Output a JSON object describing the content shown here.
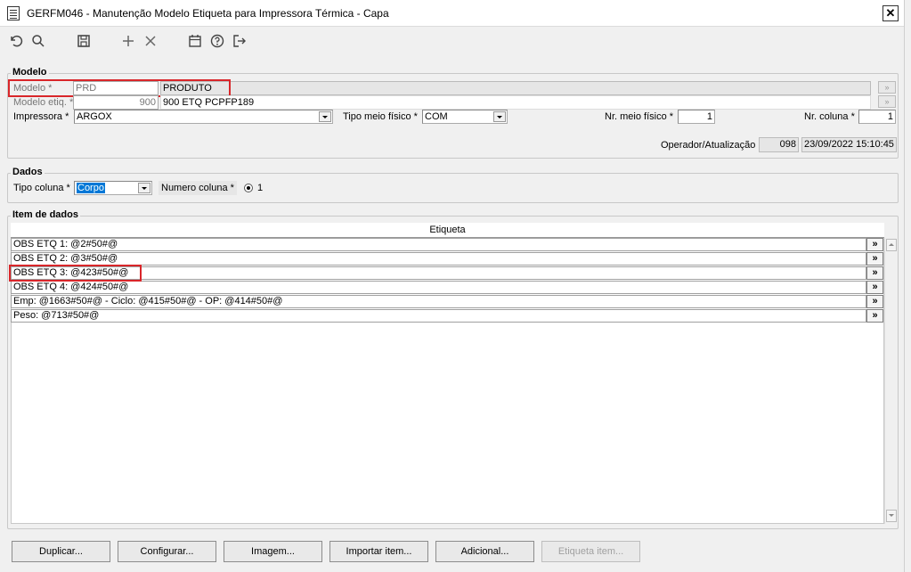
{
  "window": {
    "title": "GERFM046 - Manutenção Modelo Etiqueta para Impressora Térmica - Capa",
    "close_label": "✕"
  },
  "toolbar": {
    "icons": [
      "undo-icon",
      "search-icon",
      "save-icon",
      "add-icon",
      "delete-icon",
      "calendar-icon",
      "help-icon",
      "exit-icon"
    ]
  },
  "modelo": {
    "group_label": "Modelo",
    "modelo_label": "Modelo *",
    "modelo_value": "PRD",
    "modelo_desc": "PRODUTO",
    "modelo_etiq_label": "Modelo etiq. *",
    "modelo_etiq_value": "900",
    "modelo_etiq_desc": "900 ETQ PCPFP189",
    "impressora_label": "Impressora *",
    "impressora_value": "ARGOX",
    "tipo_meio_label": "Tipo meio físico *",
    "tipo_meio_value": "COM",
    "nr_meio_label": "Nr. meio físico *",
    "nr_meio_value": "1",
    "nr_coluna_label": "Nr. coluna *",
    "nr_coluna_value": "1",
    "operador_label": "Operador/Atualização",
    "operador_value": "098",
    "atualizacao_value": "23/09/2022 15:10:45",
    "lookup_label": "»"
  },
  "dados": {
    "group_label": "Dados",
    "tipo_coluna_label": "Tipo coluna *",
    "tipo_coluna_value": "Corpo",
    "numero_coluna_label": "Numero coluna *",
    "numero_coluna_value": "1"
  },
  "itens": {
    "group_label": "Item de dados",
    "column_header": "Etiqueta",
    "row_button_label": "»",
    "rows": [
      "OBS ETQ 1: @2#50#@",
      "OBS ETQ 2: @3#50#@",
      "OBS ETQ 3: @423#50#@",
      "OBS ETQ 4: @424#50#@",
      "Emp: @1663#50#@ - Ciclo: @415#50#@ - OP: @414#50#@",
      "Peso: @713#50#@"
    ]
  },
  "buttons": {
    "duplicar": "Duplicar...",
    "configurar": "Configurar...",
    "imagem": "Imagem...",
    "importar": "Importar item...",
    "adicional": "Adicional...",
    "etiqueta_item": "Etiqueta item..."
  },
  "colors": {
    "highlight_red": "#d9262a",
    "selected_blue": "#0078d7"
  }
}
